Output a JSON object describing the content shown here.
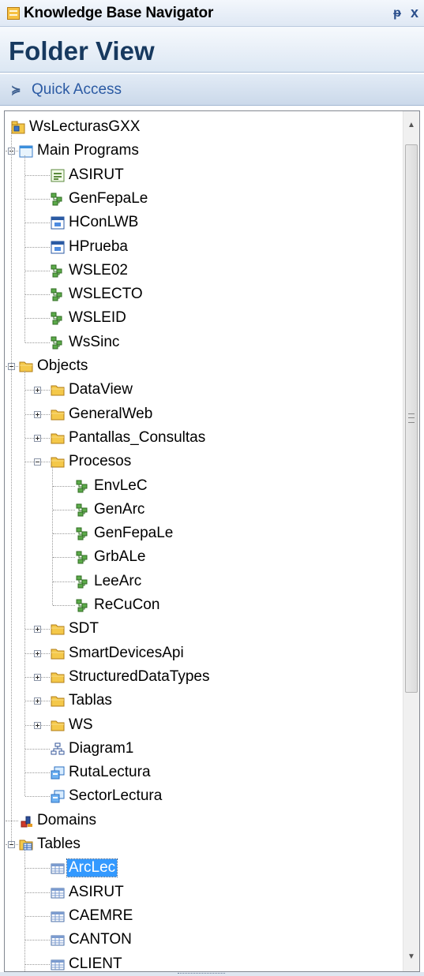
{
  "panel": {
    "title": "Knowledge Base Navigator",
    "pin_label": "ᵽ",
    "close_label": "x",
    "view_title": "Folder View",
    "quick_access_label": "Quick Access",
    "quick_chevron": "≽"
  },
  "tree": {
    "items": [
      {
        "label": "WsLecturasGXX",
        "icon": "kb-root-icon",
        "depth": 0,
        "expander": "none"
      },
      {
        "label": "Main Programs",
        "icon": "main-programs-icon",
        "depth": 1,
        "expander": "minus"
      },
      {
        "label": "ASIRUT",
        "icon": "webpanel-icon",
        "depth": 2,
        "expander": "none"
      },
      {
        "label": "GenFepaLe",
        "icon": "procedure-icon",
        "depth": 2,
        "expander": "none"
      },
      {
        "label": "HConLWB",
        "icon": "window-icon",
        "depth": 2,
        "expander": "none"
      },
      {
        "label": "HPrueba",
        "icon": "window-icon",
        "depth": 2,
        "expander": "none"
      },
      {
        "label": "WSLE02",
        "icon": "procedure-icon",
        "depth": 2,
        "expander": "none"
      },
      {
        "label": "WSLECTO",
        "icon": "procedure-icon",
        "depth": 2,
        "expander": "none"
      },
      {
        "label": "WSLEID",
        "icon": "procedure-icon",
        "depth": 2,
        "expander": "none"
      },
      {
        "label": "WsSinc",
        "icon": "procedure-icon",
        "depth": 2,
        "expander": "none"
      },
      {
        "label": "Objects",
        "icon": "folder-icon",
        "depth": 1,
        "expander": "minus"
      },
      {
        "label": "DataView",
        "icon": "folder-icon",
        "depth": 2,
        "expander": "plus"
      },
      {
        "label": "GeneralWeb",
        "icon": "folder-icon",
        "depth": 2,
        "expander": "plus"
      },
      {
        "label": "Pantallas_Consultas",
        "icon": "folder-icon",
        "depth": 2,
        "expander": "plus"
      },
      {
        "label": "Procesos",
        "icon": "folder-icon",
        "depth": 2,
        "expander": "minus"
      },
      {
        "label": "EnvLeC",
        "icon": "procedure-icon",
        "depth": 3,
        "expander": "none"
      },
      {
        "label": "GenArc",
        "icon": "procedure-icon",
        "depth": 3,
        "expander": "none"
      },
      {
        "label": "GenFepaLe",
        "icon": "procedure-icon",
        "depth": 3,
        "expander": "none"
      },
      {
        "label": "GrbALe",
        "icon": "procedure-icon",
        "depth": 3,
        "expander": "none"
      },
      {
        "label": "LeeArc",
        "icon": "procedure-icon",
        "depth": 3,
        "expander": "none"
      },
      {
        "label": "ReCuCon",
        "icon": "procedure-icon",
        "depth": 3,
        "expander": "none"
      },
      {
        "label": "SDT",
        "icon": "folder-icon",
        "depth": 2,
        "expander": "plus"
      },
      {
        "label": "SmartDevicesApi",
        "icon": "folder-icon",
        "depth": 2,
        "expander": "plus"
      },
      {
        "label": "StructuredDataTypes",
        "icon": "folder-icon",
        "depth": 2,
        "expander": "plus"
      },
      {
        "label": "Tablas",
        "icon": "folder-icon",
        "depth": 2,
        "expander": "plus"
      },
      {
        "label": "WS",
        "icon": "folder-icon",
        "depth": 2,
        "expander": "plus"
      },
      {
        "label": "Diagram1",
        "icon": "diagram-icon",
        "depth": 2,
        "expander": "none"
      },
      {
        "label": "RutaLectura",
        "icon": "transaction-icon",
        "depth": 2,
        "expander": "none"
      },
      {
        "label": "SectorLectura",
        "icon": "transaction-icon",
        "depth": 2,
        "expander": "none"
      },
      {
        "label": "Domains",
        "icon": "domains-icon",
        "depth": 1,
        "expander": "none"
      },
      {
        "label": "Tables",
        "icon": "tables-folder-icon",
        "depth": 1,
        "expander": "minus"
      },
      {
        "label": "ArcLec",
        "icon": "table-icon",
        "depth": 2,
        "expander": "none",
        "selected": true
      },
      {
        "label": "ASIRUT",
        "icon": "table-icon",
        "depth": 2,
        "expander": "none"
      },
      {
        "label": "CAEMRE",
        "icon": "table-icon",
        "depth": 2,
        "expander": "none"
      },
      {
        "label": "CANTON",
        "icon": "table-icon",
        "depth": 2,
        "expander": "none"
      },
      {
        "label": "CLIENT",
        "icon": "table-icon",
        "depth": 2,
        "expander": "none"
      }
    ]
  },
  "scrollbar": {
    "up_arrow": "▲",
    "down_arrow": "▼",
    "position": 0.0
  }
}
